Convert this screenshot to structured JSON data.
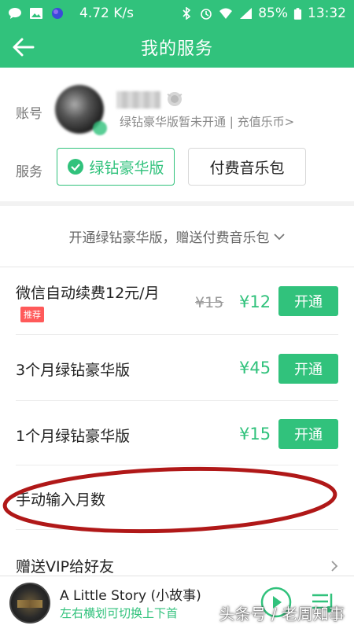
{
  "status_bar": {
    "speed": "4.72 K/s",
    "battery": "85%",
    "time": "13:32"
  },
  "header": {
    "title": "我的服务"
  },
  "account": {
    "account_label": "账号",
    "description": "绿钻豪华版暂未开通 | 充值乐币>",
    "service_label": "服务",
    "services": [
      {
        "label": "绿钻豪华版",
        "selected": true
      },
      {
        "label": "付费音乐包",
        "selected": false
      }
    ]
  },
  "promo": {
    "banner": "开通绿钻豪华版，赠送付费音乐包"
  },
  "plans": [
    {
      "name": "微信自动续费12元/月",
      "badge": "推荐",
      "old_price": "¥15",
      "price": "¥12",
      "button": "开通"
    },
    {
      "name": "3个月绿钻豪华版",
      "price": "¥45",
      "button": "开通"
    },
    {
      "name": "1个月绿钻豪华版",
      "price": "¥15",
      "button": "开通"
    }
  ],
  "manual": {
    "label": "手动输入月数"
  },
  "gift": {
    "label": "赠送VIP给好友"
  },
  "player": {
    "song_title": "A Little Story (小故事)",
    "hint": "左右横划可切换上下首",
    "watermark": "头条号 / 老周知事"
  },
  "colors": {
    "brand": "#31c27c",
    "badge": "#ff5a5a",
    "annotation": "#b01818"
  }
}
